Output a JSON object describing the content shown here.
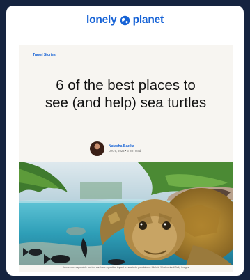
{
  "brand": {
    "name_left": "lonely",
    "name_right": "planet",
    "color": "#1763d6"
  },
  "article": {
    "category": "Travel Stories",
    "headline_line1": "6 of the best places to",
    "headline_line2": "see (and help) sea turtles",
    "author": "Natasha Bazika",
    "meta": "Dec 6, 2024 • 6 min read",
    "hero_caption": "Here's how responsible tourism can have a positive impact on sea turtle populations. Michele Westmorland/Getty Images"
  },
  "icons": {
    "logo": "globe-icon",
    "avatar": "author-avatar"
  }
}
